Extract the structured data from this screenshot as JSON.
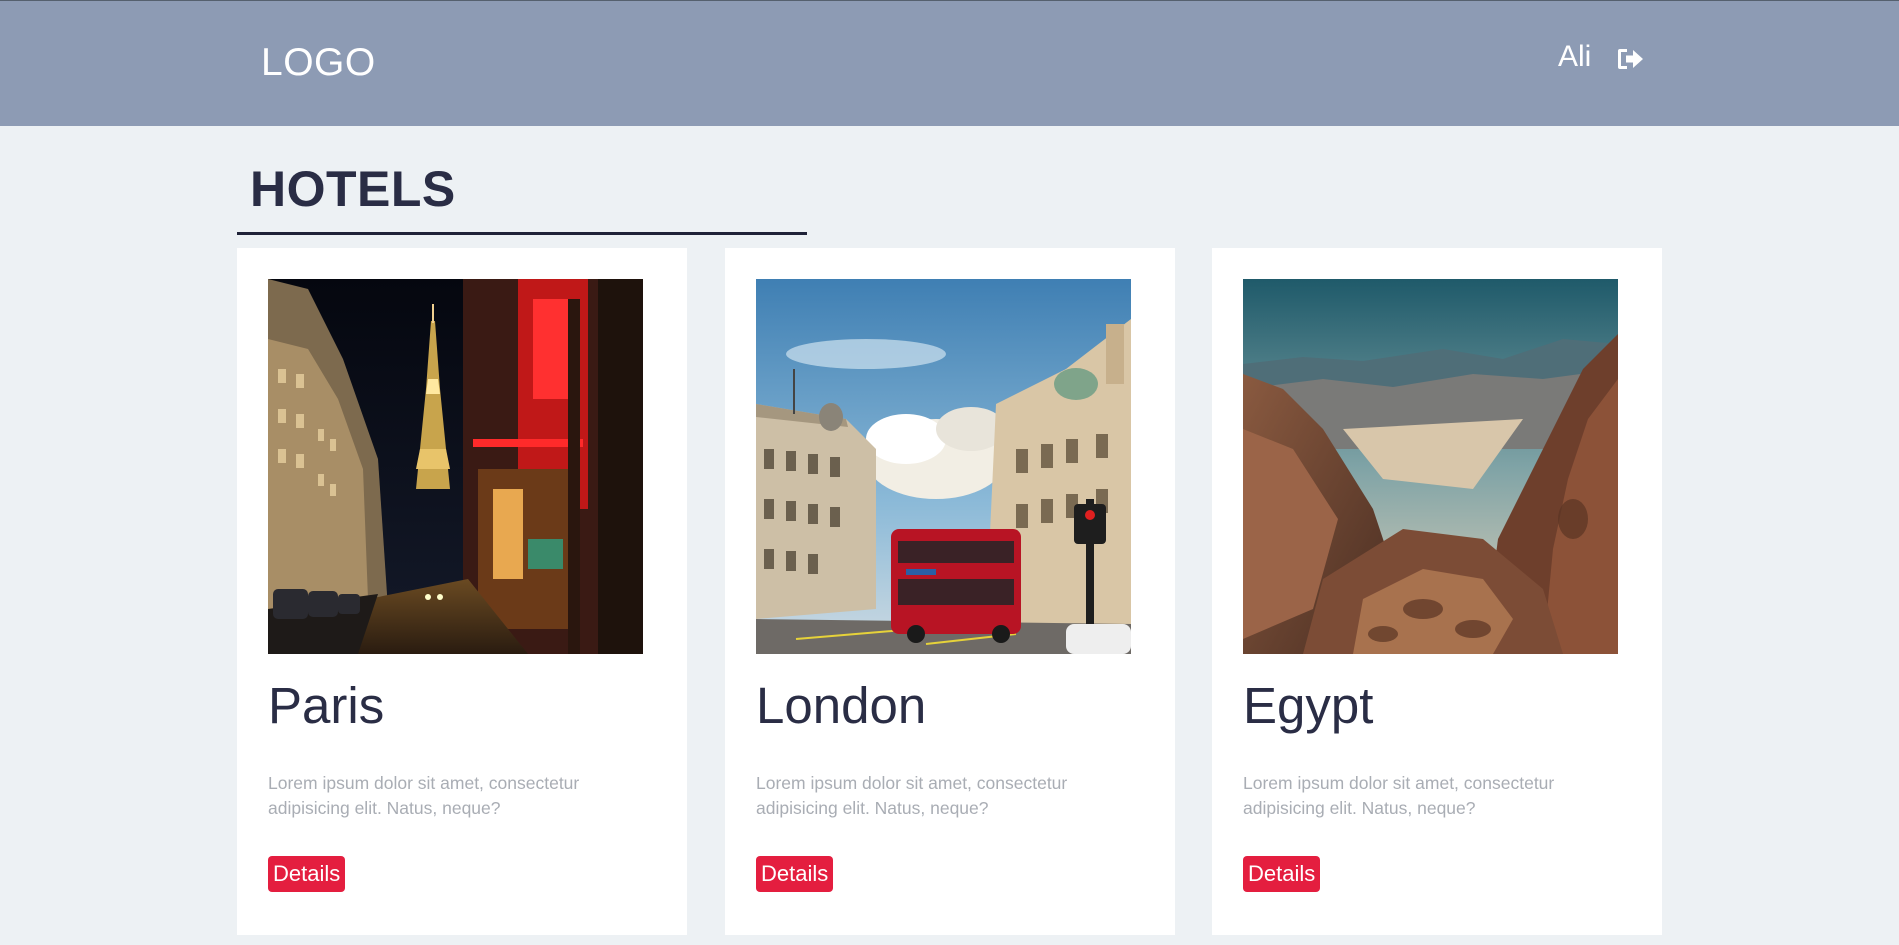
{
  "header": {
    "logo": "LOGO",
    "user_name": "Ali",
    "logout_icon": "sign-out-icon"
  },
  "page": {
    "title": "HOTELS"
  },
  "cards": [
    {
      "city": "Paris",
      "description": "Lorem ipsum dolor sit amet, consectetur adipisicing elit. Natus, neque?",
      "button_label": "Details",
      "image": "paris-night-street-eiffel-tower-photo"
    },
    {
      "city": "London",
      "description": "Lorem ipsum dolor sit amet, consectetur adipisicing elit. Natus, neque?",
      "button_label": "Details",
      "image": "london-piccadilly-red-bus-photo"
    },
    {
      "city": "Egypt",
      "description": "Lorem ipsum dolor sit amet, consectetur adipisicing elit. Natus, neque?",
      "button_label": "Details",
      "image": "egypt-sinai-mountains-photo"
    }
  ],
  "colors": {
    "header_bg": "#8d9bb4",
    "page_bg": "#edf1f4",
    "title_text": "#2a2d45",
    "button_bg": "#e41e3f",
    "desc_text": "#a9adb4"
  }
}
